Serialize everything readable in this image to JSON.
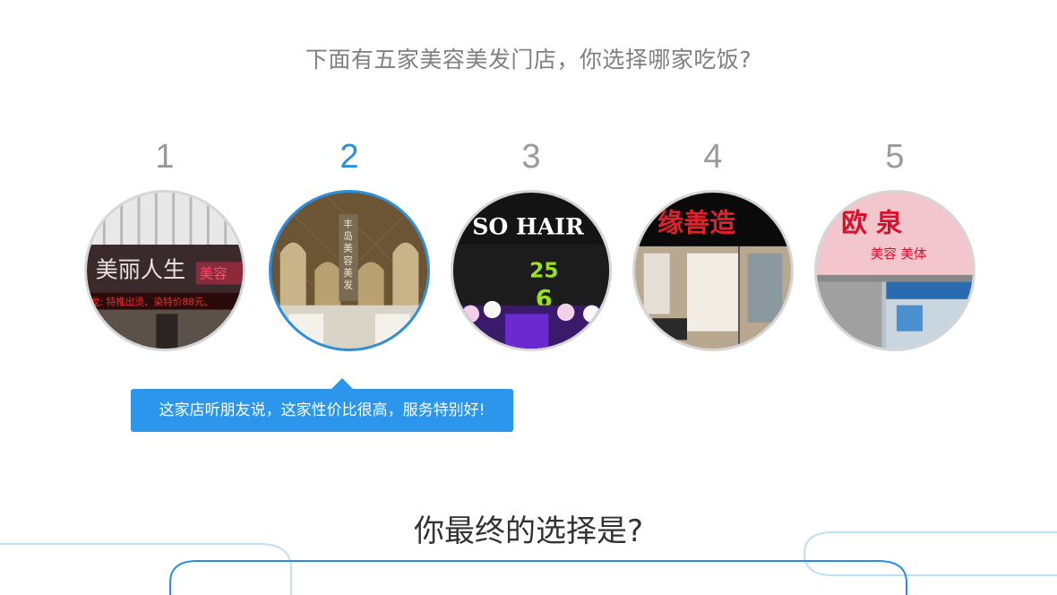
{
  "question": "下面有五家美容美发门店，你选择哪家吃饭?",
  "stores": [
    {
      "number": "1",
      "sign_text": "美丽人生",
      "sign_sub": "美容",
      "banner": "龙: 特推出烫、染特价88元、"
    },
    {
      "number": "2",
      "sign_text": "丰岛美容美发",
      "selected": true
    },
    {
      "number": "3",
      "sign_text": "SO HAIR",
      "banner": "25",
      "banner2": "6"
    },
    {
      "number": "4",
      "sign_text": "缘善造"
    },
    {
      "number": "5",
      "sign_text": "欧 泉",
      "sign_sub": "美容 美体"
    }
  ],
  "tooltip": "这家店听朋友说，这家性价比很高，服务特别好!",
  "final_question": "你最终的选择是?",
  "colors": {
    "accent": "#2a8fe0",
    "tooltip_bg": "#2b96ec",
    "text_gray": "#808080"
  }
}
